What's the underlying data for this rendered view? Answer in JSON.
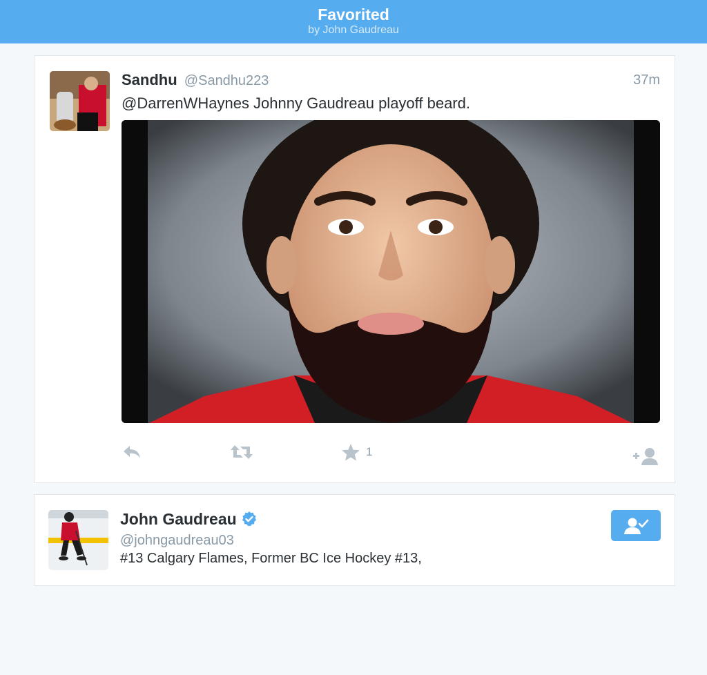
{
  "header": {
    "title": "Favorited",
    "subtitle": "by John Gaudreau"
  },
  "tweet": {
    "author_name": "Sandhu",
    "author_handle": "@Sandhu223",
    "timestamp": "37m",
    "text": "@DarrenWHaynes Johnny Gaudreau playoff beard.",
    "favorite_count": "1",
    "icons": [
      "reply-icon",
      "retweet-icon",
      "favorite-icon",
      "follow-icon"
    ]
  },
  "user": {
    "name": "John Gaudreau",
    "handle": "@johngaudreau03",
    "bio": "#13 Calgary Flames, Former BC Ice Hockey #13,",
    "verified": true
  },
  "colors": {
    "header_bg": "#55acee",
    "page_bg": "#f5f8fa",
    "action_icon": "#b8c3cc",
    "muted_text": "#8899a6"
  }
}
